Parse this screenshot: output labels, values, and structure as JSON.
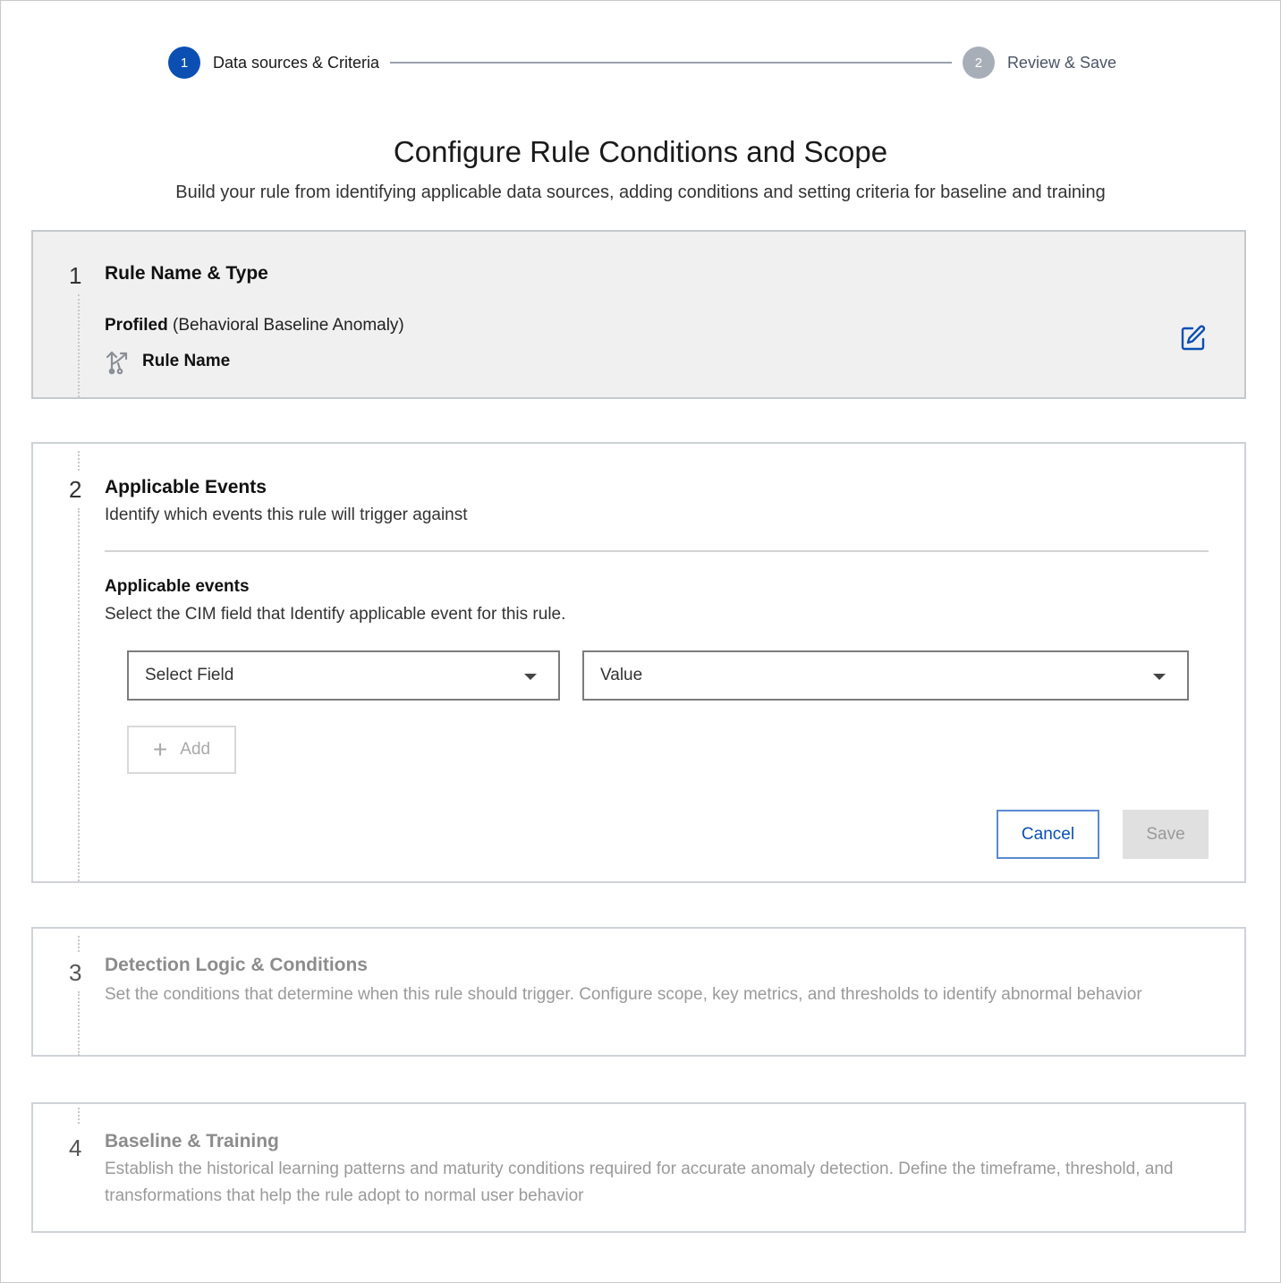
{
  "stepper": {
    "steps": [
      {
        "number": "1",
        "label": "Data sources & Criteria",
        "state": "active"
      },
      {
        "number": "2",
        "label": "Review & Save",
        "state": "inactive"
      }
    ]
  },
  "header": {
    "title": "Configure Rule Conditions and Scope",
    "subtitle": "Build your rule from identifying applicable data sources, adding conditions and setting criteria for baseline and training"
  },
  "sections": [
    {
      "number": "1",
      "title": "Rule Name & Type",
      "type_bold": "Profiled",
      "type_rest": " (Behavioral Baseline Anomaly)",
      "rule_name": "Rule Name",
      "edit_icon": "edit-icon"
    },
    {
      "number": "2",
      "title": "Applicable Events",
      "description": "Identify which events this rule will trigger against",
      "sub_title": "Applicable events",
      "sub_description": "Select the CIM field that Identify applicable event for this rule.",
      "field_placeholder": "Select Field",
      "value_placeholder": "Value",
      "add_label": "Add",
      "cancel_label": "Cancel",
      "save_label": "Save"
    },
    {
      "number": "3",
      "title": "Detection Logic & Conditions",
      "description": "Set the conditions that determine when this rule should trigger. Configure scope, key metrics, and thresholds to identify abnormal behavior"
    },
    {
      "number": "4",
      "title": "Baseline & Training",
      "description": "Establish the historical learning patterns and maturity conditions required for accurate anomaly detection. Define the timeframe, threshold, and transformations that help the rule adopt to normal user behavior"
    }
  ],
  "colors": {
    "accent": "#0b4fb3",
    "step_inactive": "#a8aeb8",
    "muted_text": "#8c8c8c"
  }
}
